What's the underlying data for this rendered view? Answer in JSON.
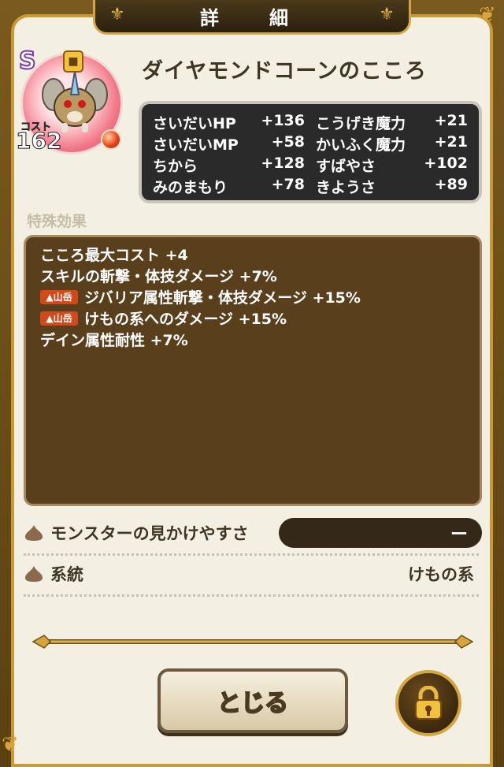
{
  "header": {
    "title": "詳　細"
  },
  "item": {
    "rank": "S",
    "name": "ダイヤモンドコーンのこころ",
    "cost_label": "コスト",
    "cost_value": "162"
  },
  "stats": [
    [
      {
        "label": "さいだいHP",
        "value": "+136"
      },
      {
        "label": "こうげき魔力",
        "value": "+21"
      }
    ],
    [
      {
        "label": "さいだいMP",
        "value": "+58"
      },
      {
        "label": "かいふく魔力",
        "value": "+21"
      }
    ],
    [
      {
        "label": "ちから",
        "value": "+128"
      },
      {
        "label": "すばやさ",
        "value": "+102"
      }
    ],
    [
      {
        "label": "みのまもり",
        "value": "+78"
      },
      {
        "label": "きようさ",
        "value": "+89"
      }
    ]
  ],
  "effects": {
    "section_label": "特殊効果",
    "items": [
      {
        "badge": "",
        "text": "こころ最大コスト +4"
      },
      {
        "badge": "",
        "text": "スキルの斬撃・体技ダメージ +7%"
      },
      {
        "badge": "山岳",
        "text": "ジバリア属性斬撃・体技ダメージ +15%"
      },
      {
        "badge": "山岳",
        "text": "けもの系へのダメージ +15%"
      },
      {
        "badge": "",
        "text": "デイン属性耐性 +7%"
      }
    ]
  },
  "info": {
    "visibility_label": "モンスターの見かけやすさ",
    "visibility_value": "ー",
    "family_label": "系統",
    "family_value": "けもの系"
  },
  "buttons": {
    "close_label": "とじる"
  },
  "colors": {
    "panel": "#f3efe2",
    "gold": "#c89a36",
    "effects_bg": "#5a3f1c",
    "stats_bg": "#2a2a2a",
    "badge": "#d24a1a"
  }
}
